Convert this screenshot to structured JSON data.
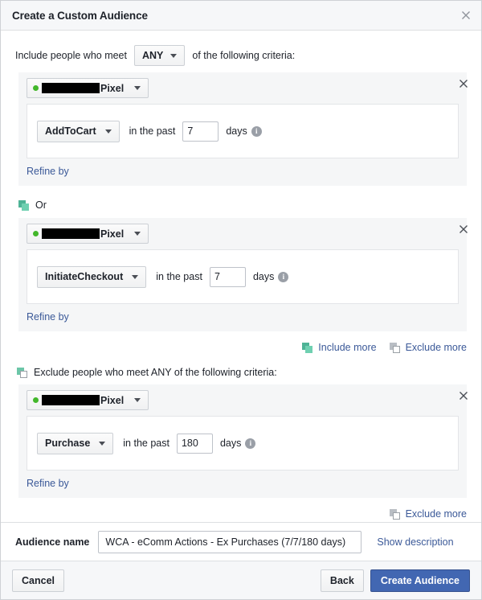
{
  "dialog": {
    "title": "Create a Custom Audience",
    "close_icon": "close-icon"
  },
  "include": {
    "prefix_label": "Include people who meet",
    "operator": "ANY",
    "suffix_label": "of the following criteria:"
  },
  "or_separator": {
    "label": "Or",
    "icon": "stacked-squares-icon"
  },
  "groups": [
    {
      "source_label": "Pixel",
      "source_status": "active",
      "event": "AddToCart",
      "in_past_label": "in the past",
      "days_value": "7",
      "days_label": "days",
      "info_icon": "info-icon",
      "refine_label": "Refine by",
      "close_icon": "close-icon"
    },
    {
      "source_label": "Pixel",
      "source_status": "active",
      "event": "InitiateCheckout",
      "in_past_label": "in the past",
      "days_value": "7",
      "days_label": "days",
      "info_icon": "info-icon",
      "refine_label": "Refine by",
      "close_icon": "close-icon"
    }
  ],
  "more_links": {
    "include_more": "Include more",
    "exclude_more": "Exclude more"
  },
  "exclude": {
    "header_label": "Exclude people who meet ANY of the following criteria:",
    "icon": "stacked-squares-outline-icon",
    "group": {
      "source_label": "Pixel",
      "source_status": "active",
      "event": "Purchase",
      "in_past_label": "in the past",
      "days_value": "180",
      "days_label": "days",
      "info_icon": "info-icon",
      "refine_label": "Refine by",
      "close_icon": "close-icon"
    },
    "exclude_more": "Exclude more"
  },
  "footer": {
    "audience_name_label": "Audience name",
    "audience_name_value": "WCA - eComm Actions - Ex Purchases (7/7/180 days)",
    "show_description": "Show description",
    "cancel_label": "Cancel",
    "back_label": "Back",
    "create_label": "Create Audience"
  },
  "colors": {
    "accent_blue": "#4267b2",
    "link_blue": "#3b5998",
    "status_green": "#42b72a",
    "group_bg": "#f5f6f7",
    "header_bg": "#f6f7f9"
  }
}
